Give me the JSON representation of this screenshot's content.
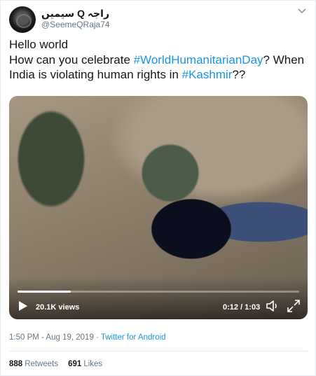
{
  "author": {
    "display_name": "راجہ Q سیمیں",
    "handle": "@SeemeQRaja74",
    "avatar_icon": "avatar-circle",
    "menu_icon": "chevron-down-icon"
  },
  "tweet": {
    "line1": "Hello world",
    "line2_pre": "How can you celebrate ",
    "hashtag1": "#WorldHumanitarianDay",
    "line2_post": "? When",
    "line3_pre": "India is violating human rights in ",
    "hashtag2": "#Kashmir",
    "line3_post": "??"
  },
  "video": {
    "views": "20.1K views",
    "time": "0:12 / 1:03",
    "progress": 0.19,
    "play_icon": "play-icon",
    "volume_icon": "volume-icon",
    "fullscreen_icon": "expand-icon"
  },
  "meta": {
    "timestamp": "1:50 PM - Aug 19, 2019",
    "separator": " · ",
    "client": "Twitter for Android"
  },
  "stats": {
    "retweets_count": "888",
    "retweets_label": "Retweets",
    "likes_count": "691",
    "likes_label": "Likes"
  },
  "colors": {
    "link": "#1b95e0",
    "muted": "#657786",
    "text": "#14171a",
    "border": "#e6ecf0"
  }
}
